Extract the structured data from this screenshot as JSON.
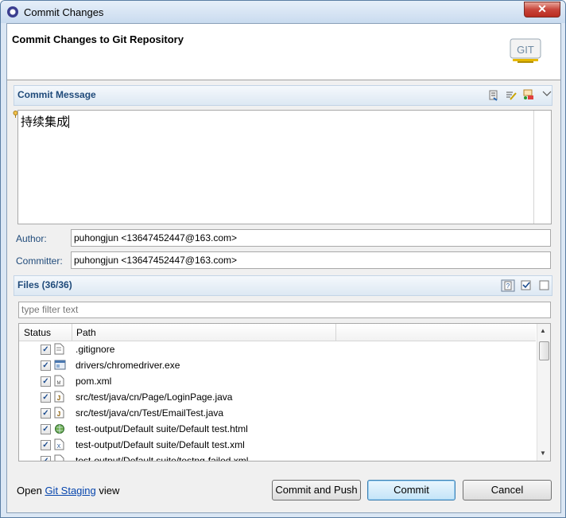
{
  "window": {
    "title": "Commit Changes",
    "close_glyph": "✕"
  },
  "header": {
    "title": "Commit Changes to Git Repository",
    "logo_text": "GIT"
  },
  "commit_message": {
    "section_title": "Commit Message",
    "text": "持续集成",
    "toolbar": [
      "previous-messages-icon",
      "spell-check-icon",
      "signed-off-icon",
      "menu-chevron-icon"
    ]
  },
  "author": {
    "label": "Author:",
    "value": "puhongjun <13647452447@163.com>"
  },
  "committer": {
    "label": "Committer:",
    "value": "puhongjun <13647452447@163.com>"
  },
  "files": {
    "section_title": "Files (36/36)",
    "filter_placeholder": "type filter text",
    "columns": [
      "Status",
      "Path"
    ],
    "rows": [
      {
        "path": ".gitignore",
        "checked": true,
        "icon": "text-file-icon"
      },
      {
        "path": "drivers/chromedriver.exe",
        "checked": true,
        "icon": "exe-file-icon"
      },
      {
        "path": "pom.xml",
        "checked": true,
        "icon": "xml-file-icon"
      },
      {
        "path": "src/test/java/cn/Page/LoginPage.java",
        "checked": true,
        "icon": "java-file-icon"
      },
      {
        "path": "src/test/java/cn/Test/EmailTest.java",
        "checked": true,
        "icon": "java-file-icon"
      },
      {
        "path": "test-output/Default suite/Default test.html",
        "checked": true,
        "icon": "html-file-icon"
      },
      {
        "path": "test-output/Default suite/Default test.xml",
        "checked": true,
        "icon": "xml-file-icon"
      },
      {
        "path": "test-output/Default suite/testng-failed.xml",
        "checked": true,
        "icon": "xml-file-icon"
      }
    ]
  },
  "footer": {
    "prefix": "Open",
    "link": "Git Staging",
    "suffix": "view"
  },
  "buttons": {
    "commit_and_push": "Commit and Push",
    "commit": "Commit",
    "cancel": "Cancel"
  }
}
